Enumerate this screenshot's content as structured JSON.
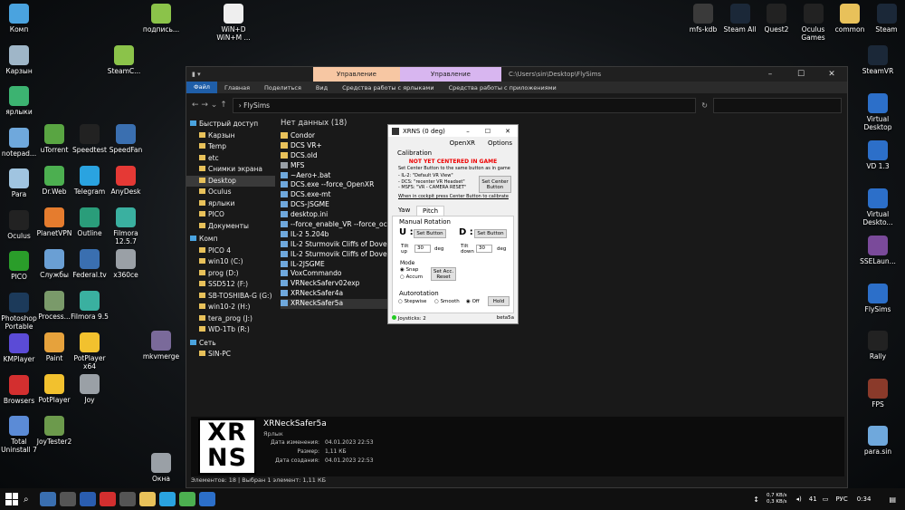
{
  "desktop_left": [
    {
      "label": "Комп",
      "icon": "computer-icon",
      "color": "#4aa3df"
    },
    {
      "label": "Карзын",
      "icon": "recycle-bin-icon",
      "color": "#9fb6c8"
    },
    {
      "label": "ярлыки",
      "icon": "shortcut-icon",
      "color": "#3cb371"
    },
    {
      "label": "notepad...",
      "icon": "notepad-icon",
      "color": "#6fa8dc"
    },
    {
      "label": "Para",
      "icon": "para-icon",
      "color": "#a0c4e0"
    },
    {
      "label": "Oculus",
      "icon": "oculus-icon",
      "color": "#222222"
    },
    {
      "label": "PICO",
      "icon": "pico-icon",
      "color": "#2a9d2a"
    },
    {
      "label": "Photoshop Portable",
      "icon": "photoshop-icon",
      "color": "#1c3a5a"
    },
    {
      "label": "KMPlayer",
      "icon": "kmplayer-icon",
      "color": "#5b4bd6"
    },
    {
      "label": "Browsers",
      "icon": "opera-icon",
      "color": "#d32f2f"
    },
    {
      "label": "Total Uninstall 7",
      "icon": "uninstall-icon",
      "color": "#5b8bd6"
    }
  ],
  "desktop_col2": [
    {
      "label": "uTorrent",
      "icon": "utorrent-icon",
      "color": "#59a542"
    },
    {
      "label": "Dr.Web",
      "icon": "drweb-icon",
      "color": "#4caf50"
    },
    {
      "label": "PlanetVPN",
      "icon": "planetvpn-icon",
      "color": "#e57c2e"
    },
    {
      "label": "Службы",
      "icon": "services-icon",
      "color": "#6a9fd4"
    },
    {
      "label": "Process...",
      "icon": "process-icon",
      "color": "#7a9a6a"
    },
    {
      "label": "Paint",
      "icon": "paint-icon",
      "color": "#e6a23c"
    },
    {
      "label": "PotPlayer",
      "icon": "potplayer-icon",
      "color": "#f2c12e"
    },
    {
      "label": "JoyTester2",
      "icon": "joytester-icon",
      "color": "#6c9a4c"
    }
  ],
  "desktop_col3": [
    {
      "label": "Speedtest",
      "icon": "speedtest-icon",
      "color": "#222222"
    },
    {
      "label": "Telegram",
      "icon": "telegram-icon",
      "color": "#2aa3e0"
    },
    {
      "label": "Outline",
      "icon": "outline-icon",
      "color": "#2a9d7a"
    },
    {
      "label": "Federal.tv",
      "icon": "federaltv-icon",
      "color": "#3a6fb0"
    },
    {
      "label": "Filmora 9.5",
      "icon": "filmora-icon",
      "color": "#3ab0a0"
    },
    {
      "label": "PotPlayer x64",
      "icon": "potplayer64-icon",
      "color": "#f2c12e"
    },
    {
      "label": "Joy",
      "icon": "joy-icon",
      "color": "#9aa0a6"
    }
  ],
  "desktop_col4": [
    {
      "label": "SpeedFan",
      "icon": "speedfan-icon",
      "color": "#3a6fb0"
    },
    {
      "label": "AnyDesk",
      "icon": "anydesk-icon",
      "color": "#e53935"
    },
    {
      "label": "Filmora 12.5.7",
      "icon": "filmora12-icon",
      "color": "#3ab0a0"
    },
    {
      "label": "x360ce",
      "icon": "x360ce-icon",
      "color": "#9aa0a6"
    }
  ],
  "desktop_col5": [
    {
      "label": "mkvmerge",
      "icon": "mkvmerge-icon",
      "color": "#7a6a9a"
    },
    {
      "label": "Окна",
      "icon": "gear-icon",
      "color": "#9aa0a6"
    }
  ],
  "desktop_top": [
    {
      "label": "подпись...",
      "icon": "signature-file-icon",
      "color": "#8bc34a"
    },
    {
      "label": "WiN+D WiN+M ...",
      "icon": "text-file-icon",
      "color": "#eeeeee"
    },
    {
      "label": "SteamC...",
      "icon": "steamc-icon",
      "color": "#8bc34a"
    }
  ],
  "desktop_right_top": [
    {
      "label": "mfs-kdb",
      "icon": "mfs-kdb-icon",
      "color": "#3a3a3a"
    },
    {
      "label": "Steam All",
      "icon": "steam-icon",
      "color": "#1b2838"
    },
    {
      "label": "Quest2",
      "icon": "quest-icon",
      "color": "#222222"
    },
    {
      "label": "Oculus Games",
      "icon": "oculus-games-icon",
      "color": "#222222"
    },
    {
      "label": "common",
      "icon": "folder-icon",
      "color": "#e8c15a"
    },
    {
      "label": "Steam",
      "icon": "steam-vr-icon",
      "color": "#1b2838"
    }
  ],
  "desktop_right_col": [
    {
      "label": "SteamVR",
      "icon": "steamvr-icon",
      "color": "#1b2838"
    },
    {
      "label": "Virtual Desktop",
      "icon": "virtual-desktop-icon",
      "color": "#2c6fc9"
    },
    {
      "label": "VD 1.3",
      "icon": "vd-icon",
      "color": "#2c6fc9"
    },
    {
      "label": "Virtual Deskto...",
      "icon": "virtual-desktop2-icon",
      "color": "#2c6fc9"
    },
    {
      "label": "SSELaun...",
      "icon": "sse-icon",
      "color": "#7a4a9a"
    },
    {
      "label": "FlySims",
      "icon": "flysims-icon",
      "color": "#2c6fc9"
    },
    {
      "label": "Rally",
      "icon": "rally-icon",
      "color": "#222222"
    },
    {
      "label": "FPS",
      "icon": "fps-icon",
      "color": "#8a3a2a"
    },
    {
      "label": "para.sin",
      "icon": "para-sin-icon",
      "color": "#6fa8dc"
    }
  ],
  "explorer": {
    "ctx_tab1": "Управление",
    "ctx_tab2": "Управление",
    "path": "C:\\Users\\sin\\Desktop\\FlySims",
    "ribbon": [
      "Файл",
      "Главная",
      "Поделиться",
      "Вид",
      "Средства работы с ярлыками",
      "Средства работы с приложениями"
    ],
    "address": "FlySims",
    "search_placeholder": "",
    "nav": [
      {
        "label": "Быстрый доступ",
        "sec": true
      },
      {
        "label": "Карзын"
      },
      {
        "label": "Temp"
      },
      {
        "label": "etc"
      },
      {
        "label": "Снимки экрана"
      },
      {
        "label": "Desktop"
      },
      {
        "label": "Oculus"
      },
      {
        "label": "ярлыки"
      },
      {
        "label": "PICO"
      },
      {
        "label": "Документы"
      },
      {
        "label": "Комп",
        "sec": true
      },
      {
        "label": "PICO 4"
      },
      {
        "label": "win10 (C:)"
      },
      {
        "label": "prog (D:)"
      },
      {
        "label": "SSD512 (F:)"
      },
      {
        "label": "SB-TOSHIBA-G (G:)"
      },
      {
        "label": "win10-2 (H:)"
      },
      {
        "label": "tera_prog (J:)"
      },
      {
        "label": "WD-1Tb (R:)"
      },
      {
        "label": "Сеть",
        "sec": true
      },
      {
        "label": "SIN-PC"
      }
    ],
    "group_header": "Нет данных (18)",
    "files": [
      "Condor",
      "DCS VR+",
      "DCS.old",
      "MFS",
      "~Aero+.bat",
      "DCS.exe --force_OpenXR",
      "DCS.exe-mt",
      "DCS-JSGME",
      "desktop.ini",
      "--force_enable_VR --force_oculus",
      "IL-2 5.204b",
      "IL-2 Sturmovik Cliffs of Dover B",
      "IL-2 Sturmovik Cliffs of Dover B",
      "IL-2JSGME",
      "VoxCommando",
      "VRNeckSaferv02exp",
      "XRNeckSafer4a",
      "XRNeckSafer5a"
    ],
    "details": {
      "name": "XRNeckSafer5a",
      "type": "Ярлык",
      "rows": [
        {
          "k": "Дата изменения:",
          "v": "04.01.2023 22:53"
        },
        {
          "k": "Размер:",
          "v": "1,11 КБ"
        },
        {
          "k": "Дата создания:",
          "v": "04.01.2023 22:53"
        }
      ],
      "logo_top": "XR",
      "logo_bottom": "NS"
    },
    "status": "Элементов: 18  |  Выбран 1 элемент: 1,11 КБ"
  },
  "xrns": {
    "title": "XRNS (0 deg)",
    "menu": [
      "OpenXR",
      "Options"
    ],
    "calibration": "Calibration",
    "warning": "NOT YET CENTERED IN GAME",
    "instr1": "Set Center Button to the same button as in game",
    "instr2": "- IL-2:    \"Default VR View\"",
    "instr3": "- DCS:    \"recenter VR Headset\"",
    "instr4": "- MSFS:  \"VR - CAMERA RESET\"",
    "instr5": "When in cockpit press Center Button to calibrate",
    "center_btn": "Set Center Button",
    "tabs": [
      "Yaw",
      "Pitch"
    ],
    "manual": "Manual Rotation",
    "u": "U :",
    "d": "D :",
    "set_button": "Set Button",
    "tilt_up": "Tilt up",
    "tilt_down": "Tilt down",
    "tilt_up_val": "30",
    "tilt_down_val": "30",
    "deg": "deg",
    "mode": "Mode",
    "snap": "Snap",
    "accum": "Accum",
    "set_acc": "Set Acc. Reset",
    "autorotation": "Autorotation",
    "stepwise": "Stepwise",
    "smooth": "Smooth",
    "off": "Off",
    "hold": "Hold",
    "joysticks": "Joysticks: 2",
    "version": "beta5a"
  },
  "taskbar": {
    "net_up": "0,7 KB/s",
    "net_down": "0,3 KB/s",
    "temp": "41",
    "lang": "РУС",
    "time": "0:34"
  }
}
